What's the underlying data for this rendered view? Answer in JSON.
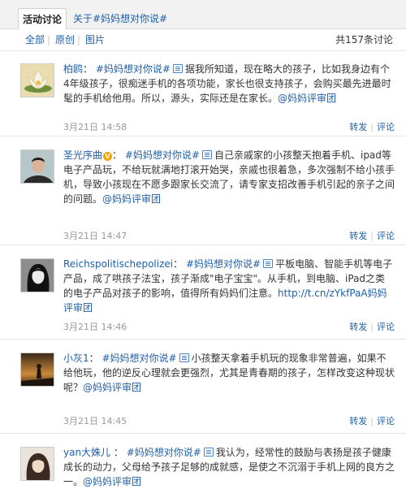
{
  "tabs": {
    "active": "活动讨论",
    "topic_link": "关于#妈妈想对你说#"
  },
  "filter": {
    "all": "全部",
    "original": "原创",
    "images": "图片",
    "count": "共157条讨论"
  },
  "colors": {
    "link": "#1f5fa8",
    "meta": "#999999",
    "verified": "#f4a300"
  },
  "actions": {
    "forward": "转发",
    "comment": "评论"
  },
  "posts": [
    {
      "author": "柏鸥",
      "colon": "：",
      "topic": "#妈妈想对你说#",
      "text": "据我所知道，现在略大的孩子，比如我身边有个4年级孩子，很痴迷手机的各项功能，家长也很支持孩子，会购买最先进最时髦的手机给他用。所以，源头，实际还是在家长。",
      "mention": "@妈妈评审团",
      "time": "3月21日 14:58",
      "avatar_icon": "lotus-flower-avatar"
    },
    {
      "author": "圣光序曲",
      "colon": "：",
      "verified": "V",
      "topic": "#妈妈想对你说#",
      "text": "自己亲戚家的小孩整天抱着手机、ipad等电子产品玩，不给玩就满地打滚开始哭，亲戚也很着急，多次强制不给小孩手机，导致小孩现在不愿多跟家长交流了，请专家支招改善手机引起的亲子之间的问题。",
      "mention": "@妈妈评审团",
      "time": "3月21日 14:47",
      "avatar_icon": "man-portrait-avatar"
    },
    {
      "author": "Reichspolitischepolizei",
      "colon": "：",
      "topic": "#妈妈想对你说#",
      "text": "平板电脑、智能手机等电子产品，成了哄孩子法宝，孩子渐成\"电子宝宝\"。从手机，到电脑、iPad之类的电子产品对孩子的影响，值得所有妈妈们注意。",
      "link": "http://t.cn/zYkfPaA",
      "mention": "妈妈评审团",
      "time": "3月21日 14:46",
      "avatar_icon": "woman-portrait-avatar"
    },
    {
      "author": "小灰1",
      "colon": "：",
      "topic": "#妈妈想对你说#",
      "text": "小孩整天拿着手机玩的现象非常普遍，如果不给他玩，他的逆反心理就会更强烈，尤其是青春期的孩子，怎样改变这种现状呢？",
      "mention": "@妈妈评审团",
      "time": "3月21日 14:45",
      "avatar_icon": "sunset-silhouette-avatar"
    },
    {
      "author": "yan大姝儿",
      "colon": " ：",
      "topic": "#妈妈想对你说#",
      "text": "我认为，经常性的鼓励与表扬是孩子健康成长的动力，父母给予孩子足够的成就感，是使之不沉溺于手机上网的良方之一。",
      "mention": "@妈妈评审团",
      "time": "",
      "avatar_icon": "girl-portrait-avatar"
    }
  ]
}
